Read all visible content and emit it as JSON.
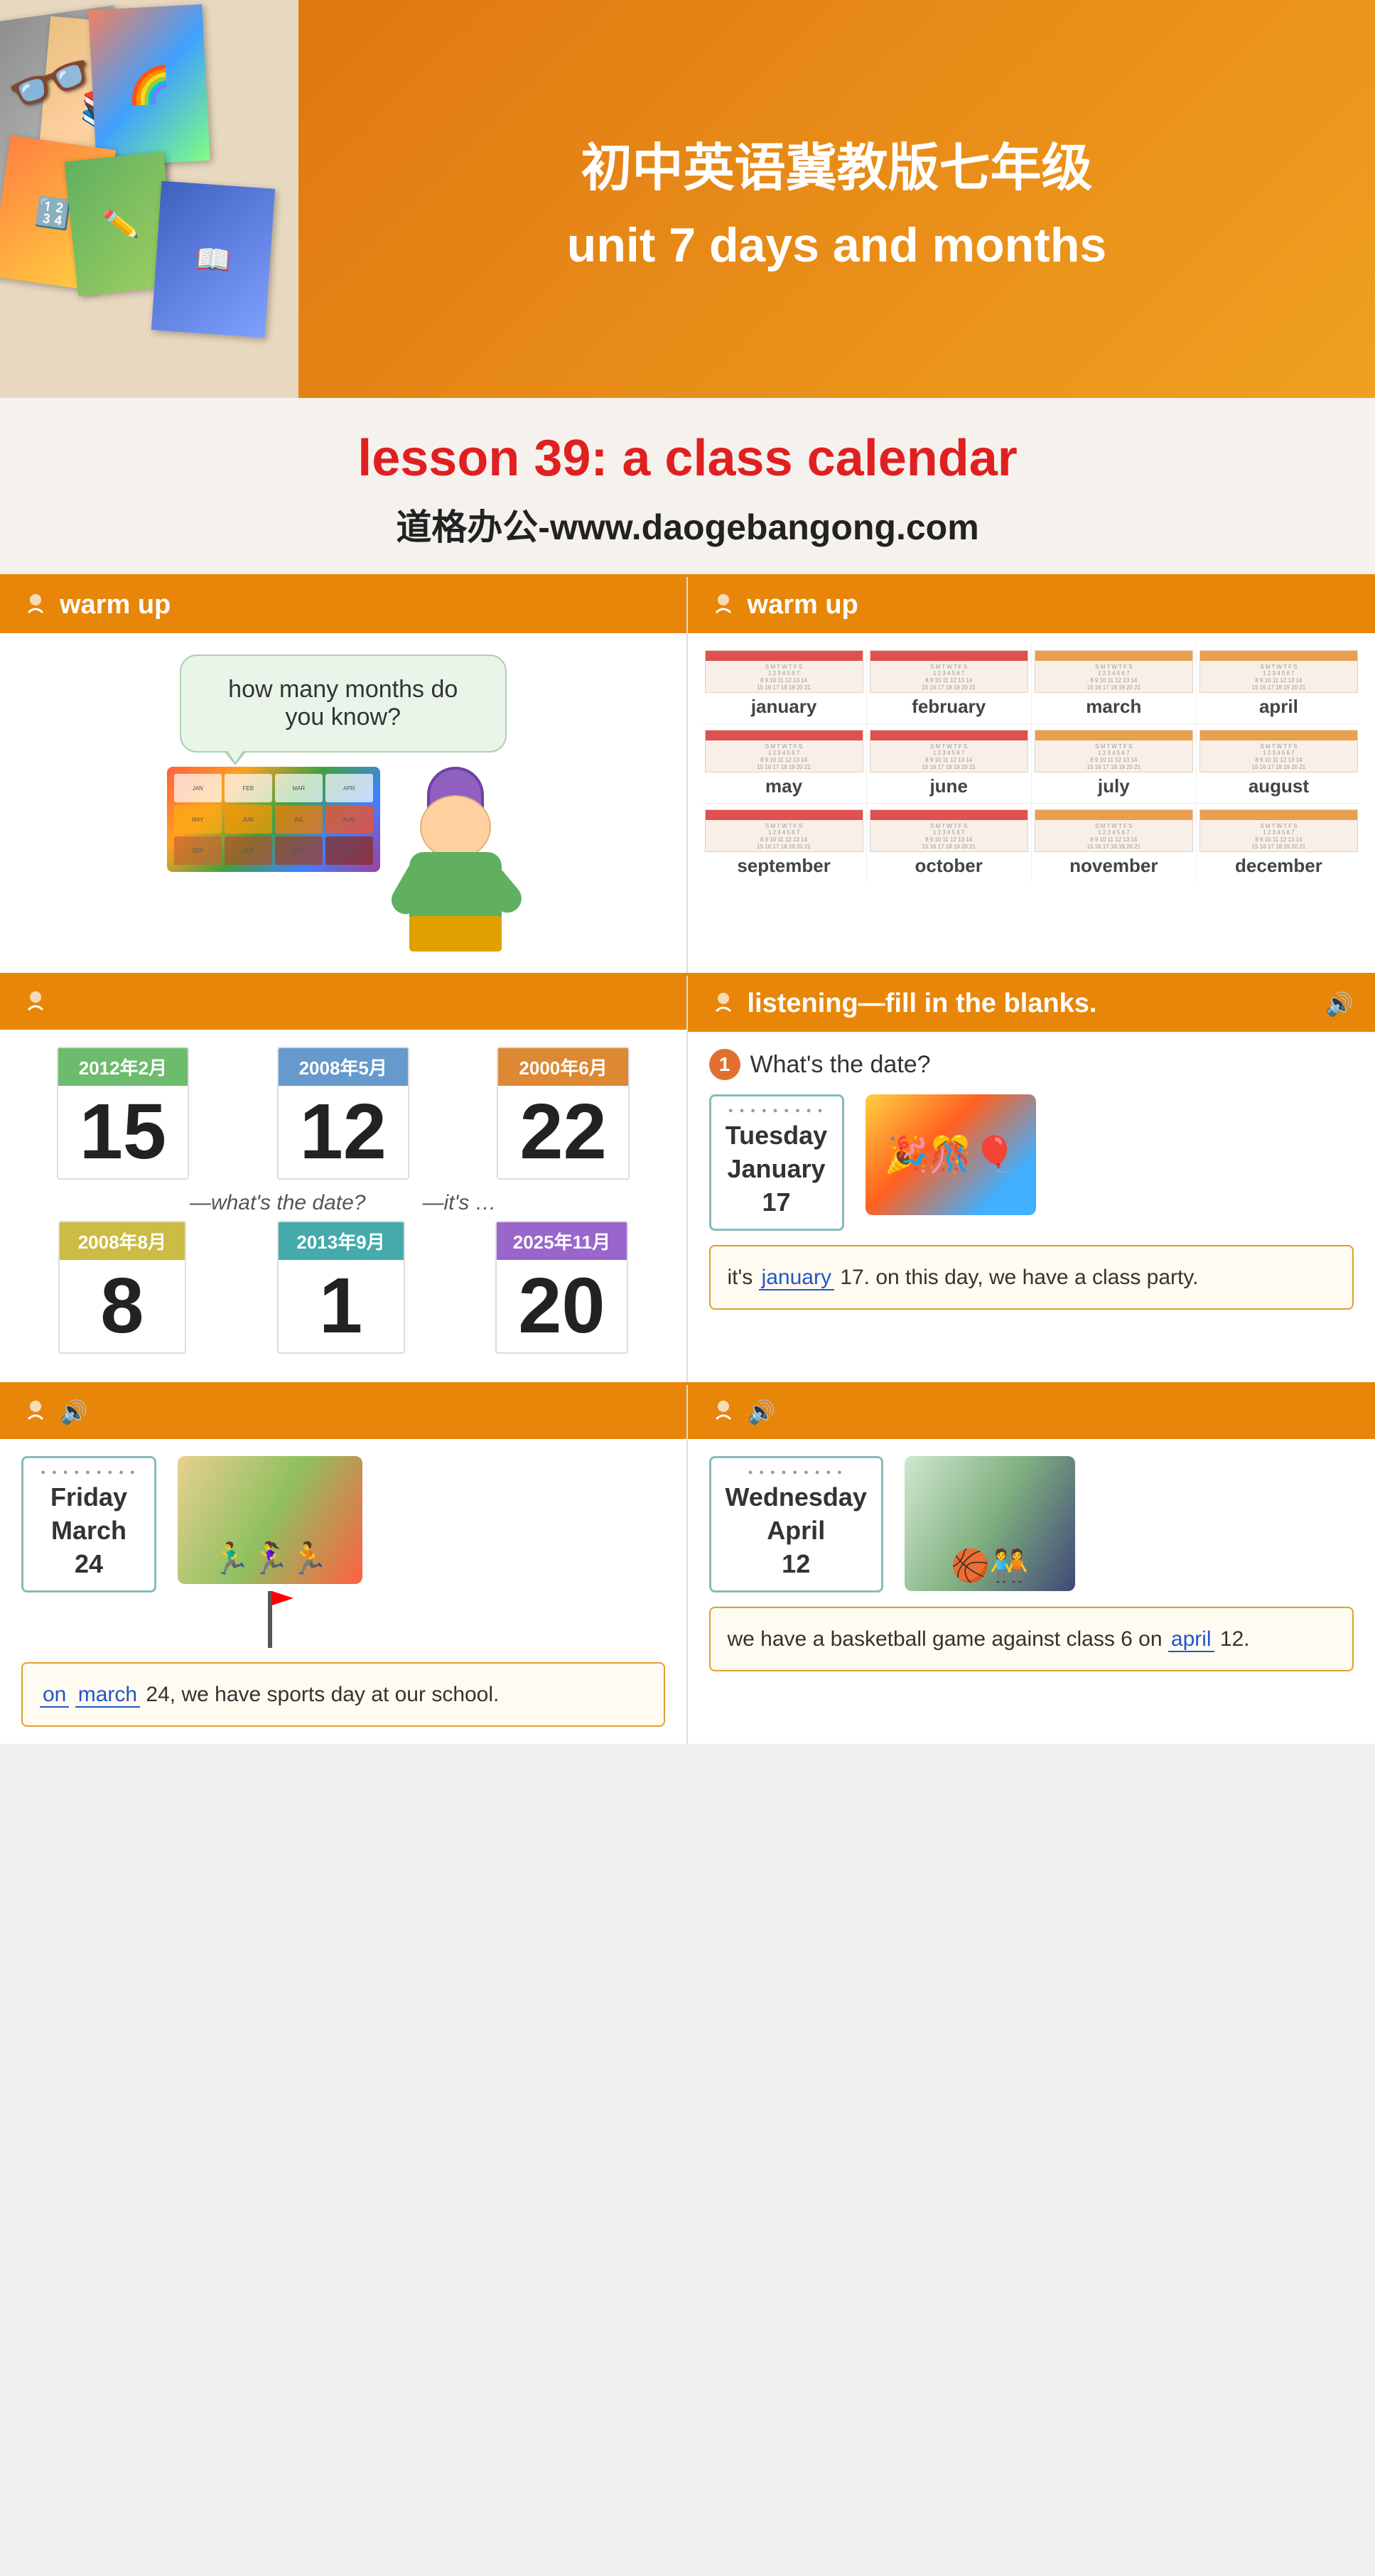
{
  "header": {
    "title1": "初中英语冀教版七年级",
    "title2": "unit 7  days and months",
    "lesson": "lesson 39: a class calendar",
    "website": "道格办公-www.daogebangong.com"
  },
  "warmup": {
    "section_label": "warm up",
    "left": {
      "question": "how many months do you know?"
    },
    "right": {
      "months": [
        {
          "name": "january"
        },
        {
          "name": "february"
        },
        {
          "name": "march"
        },
        {
          "name": "april"
        },
        {
          "name": "may"
        },
        {
          "name": "june"
        },
        {
          "name": "july"
        },
        {
          "name": "august"
        },
        {
          "name": "september"
        },
        {
          "name": "october"
        },
        {
          "name": "november"
        },
        {
          "name": "december"
        }
      ]
    }
  },
  "dates_panel": {
    "row1": [
      {
        "year_label": "2012年2月",
        "number": "15",
        "color": "bg-green"
      },
      {
        "year_label": "2008年5月",
        "number": "12",
        "color": "bg-blue"
      },
      {
        "year_label": "2000年6月",
        "number": "22",
        "color": "bg-orange"
      }
    ],
    "what_date": "—what's the date?",
    "its": "—it's …",
    "row2": [
      {
        "year_label": "2008年8月",
        "number": "8",
        "color": "bg-yellow"
      },
      {
        "year_label": "2013年9月",
        "number": "1",
        "color": "bg-teal"
      },
      {
        "year_label": "2025年11月",
        "number": "20",
        "color": "bg-violet"
      }
    ]
  },
  "listening_panel1": {
    "header": "listening—fill in the blanks.",
    "q1": {
      "number": "1",
      "text": "What's the date?",
      "calendar": {
        "line1": "Tuesday",
        "line2": "January",
        "line3": "17"
      },
      "answer_text": "it's ",
      "answer_word": "january",
      "answer_rest": " 17. on this day, we have a class party."
    }
  },
  "bottom_panel_left": {
    "calendar": {
      "line1": "Friday",
      "line2": "March",
      "line3": "24"
    },
    "answer_pre": "",
    "on_word": "on",
    "answer_month": "march",
    "answer_rest": " 24, we have sports day at our school."
  },
  "bottom_panel_right": {
    "calendar": {
      "line1": "Wednesday",
      "line2": "April",
      "line3": "12"
    },
    "answer_text": "we have a basketball game against class 6 on ",
    "answer_word": "april",
    "answer_rest": " 12."
  }
}
